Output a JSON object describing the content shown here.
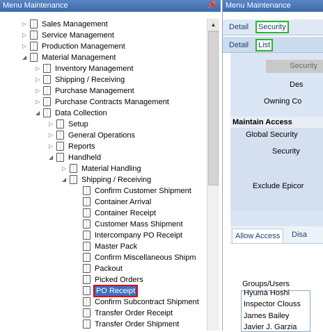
{
  "left_pane": {
    "title": "Menu Maintenance",
    "pin_icon": "pin-icon"
  },
  "tree": [
    {
      "label": "Sales Management",
      "level": 1
    },
    {
      "label": "Service Management",
      "level": 1
    },
    {
      "label": "Production Management",
      "level": 1
    },
    {
      "label": "Material Management",
      "level": 1
    },
    {
      "label": "Inventory Management",
      "level": 2
    },
    {
      "label": "Shipping / Receiving",
      "level": 2
    },
    {
      "label": "Purchase Management",
      "level": 2
    },
    {
      "label": "Purchase Contracts Management",
      "level": 2
    },
    {
      "label": "Data Collection",
      "level": 2
    },
    {
      "label": "Setup",
      "level": 3
    },
    {
      "label": "General Operations",
      "level": 3
    },
    {
      "label": "Reports",
      "level": 3
    },
    {
      "label": "Handheld",
      "level": 3
    },
    {
      "label": "Material Handling",
      "level": 4
    },
    {
      "label": "Shipping / Receiving",
      "level": 4
    },
    {
      "label": "Confirm Customer Shipment",
      "level": 5
    },
    {
      "label": "Container Arrival",
      "level": 5
    },
    {
      "label": "Container Receipt",
      "level": 5
    },
    {
      "label": "Customer Mass Shipment",
      "level": 5
    },
    {
      "label": "Intercompany PO Receipt",
      "level": 5
    },
    {
      "label": "Master Pack",
      "level": 5
    },
    {
      "label": "Confirm Miscellaneous Shipm",
      "level": 5
    },
    {
      "label": "Packout",
      "level": 5
    },
    {
      "label": "Picked Orders",
      "level": 5
    },
    {
      "label": "PO Receipt",
      "level": 5,
      "selected": true
    },
    {
      "label": "Confirm Subcontract Shipment",
      "level": 5
    },
    {
      "label": "Transfer Order Receipt",
      "level": 5
    },
    {
      "label": "Transfer Order Shipment",
      "level": 5
    }
  ],
  "right_pane": {
    "title": "Menu Maintenance",
    "tabs1": {
      "detail": "Detail",
      "security": "Security"
    },
    "tabs2": {
      "detail": "Detail",
      "list": "List"
    },
    "security_button": "Security",
    "labels": {
      "des": "Des",
      "owning": "Owning Co",
      "maintain_access": "Maintain Access",
      "global_security": "Global Security",
      "security": "Security",
      "exclude": "Exclude Epicor"
    },
    "subtabs": {
      "allow": "Allow Access",
      "disallow": "Disa"
    },
    "groups_users_label": "Groups/Users",
    "users": [
      "Hyuma Hoshi",
      "Inspector Clouss",
      "James Bailey",
      "Javier J. Garzia"
    ]
  }
}
